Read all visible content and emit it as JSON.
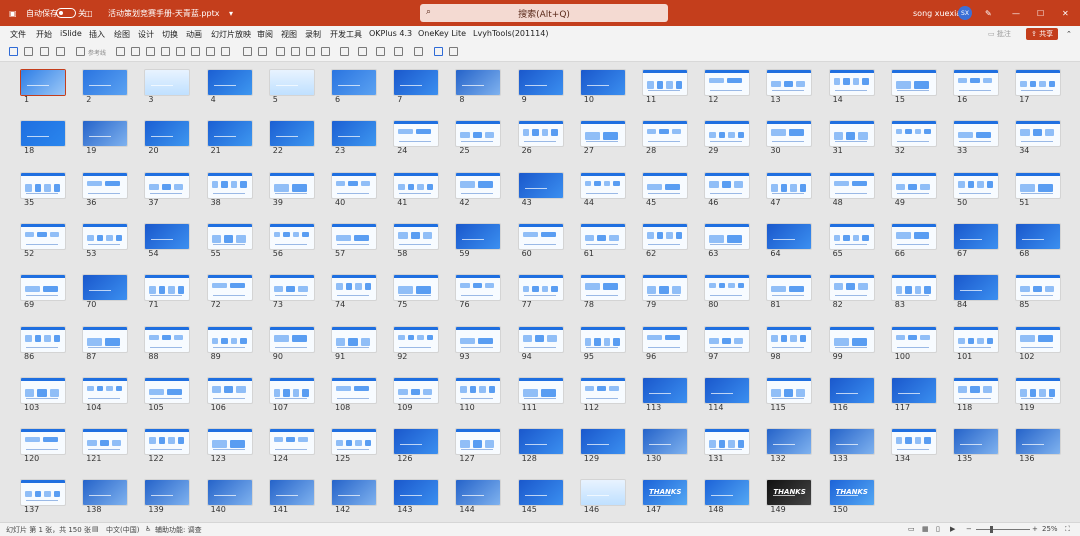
{
  "titlebar": {
    "autosave_label": "自动保存",
    "autosave_state": "关",
    "filename": "活动策划竞赛手册-天青蓝.pptx",
    "search_placeholder": "搜索(Alt+Q)",
    "user_name": "song xuexian",
    "user_initials": "SX",
    "colors": {
      "accent": "#c43e1c"
    }
  },
  "menu": {
    "items": [
      "文件",
      "开始",
      "iSlide",
      "插入",
      "绘图",
      "设计",
      "切换",
      "动画",
      "幻灯片放映",
      "审阅",
      "视图",
      "录制",
      "开发工具",
      "OKPlus 4.3",
      "OneKey Lite",
      "LvyhTools(201114)"
    ],
    "comment_label": "批注",
    "share_label": "共享"
  },
  "toolbar": {
    "reference_label": "参考线"
  },
  "sorter": {
    "total": 150,
    "selected": 1,
    "themes": {
      "1": "cover",
      "2": "toc",
      "3": "section-light",
      "4": "section-dark",
      "5": "section-light",
      "6": "toc",
      "7": "dark",
      "8": "photo",
      "9": "dark",
      "10": "dark",
      "11": "light",
      "12": "light",
      "13": "light",
      "14": "light",
      "15": "light",
      "16": "light",
      "17": "light",
      "18": "dark-num",
      "19": "photo",
      "20": "section-dark",
      "21": "section-dark",
      "22": "section-dark",
      "23": "section-dark",
      "43": "dark",
      "54": "dark",
      "59": "dark",
      "63": "light",
      "64": "dark",
      "67": "dark",
      "68": "dark",
      "70": "dark",
      "76": "light",
      "84": "dark",
      "113": "dark",
      "114": "dark",
      "116": "dark",
      "117": "dark",
      "126": "dark",
      "128": "dark",
      "129": "dark",
      "130": "photo",
      "131": "light",
      "132": "photo",
      "133": "photo",
      "135": "photo",
      "136": "photo",
      "138": "photo",
      "139": "photo",
      "140": "photo",
      "141": "photo",
      "142": "photo",
      "143": "dark",
      "144": "photo",
      "145": "dark",
      "146": "section-light",
      "147": "thanks",
      "148": "thanks",
      "149": "thanks-dark",
      "150": "thanks"
    },
    "text_on_thumbs": {
      "147": "THANKS",
      "149": "THANKS",
      "150": "THANKS"
    }
  },
  "status": {
    "slide_info": "幻灯片 第 1 张，共 150 张",
    "language": "中文(中国)",
    "accessibility": "辅助功能: 调查",
    "zoom": "25%",
    "zoom_fraction": 0.26
  }
}
